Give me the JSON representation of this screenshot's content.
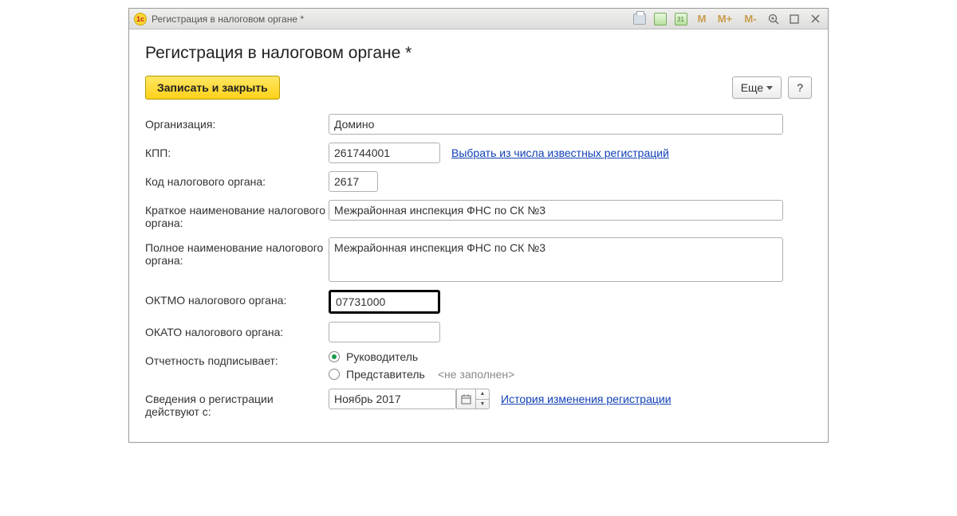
{
  "titlebar": {
    "title": "Регистрация в налоговом органе *"
  },
  "header": {
    "title": "Регистрация в налоговом органе *"
  },
  "toolbar": {
    "save_close": "Записать и закрыть",
    "more": "Еще",
    "help": "?"
  },
  "form": {
    "org_label": "Организация:",
    "org_value": "Домино",
    "kpp_label": "КПП:",
    "kpp_value": "261744001",
    "kpp_link": "Выбрать из числа известных регистраций",
    "code_label": "Код налогового органа:",
    "code_value": "2617",
    "short_label": "Краткое наименование налогового органа:",
    "short_value": "Межрайонная инспекция ФНС по СК №3",
    "full_label": "Полное наименование налогового органа:",
    "full_value": "Межрайонная инспекция ФНС по СК №3",
    "oktmo_label": "ОКТМО налогового органа:",
    "oktmo_value": "07731000",
    "okato_label": "ОКАТО налогового органа:",
    "okato_value": "",
    "signer_label": "Отчетность подписывает:",
    "signer_opt1": "Руководитель",
    "signer_opt2": "Представитель",
    "signer_empty": "<не заполнен>",
    "valid_label": "Сведения о регистрации действуют с:",
    "valid_value": "Ноябрь 2017",
    "history_link": "История изменения регистрации"
  }
}
